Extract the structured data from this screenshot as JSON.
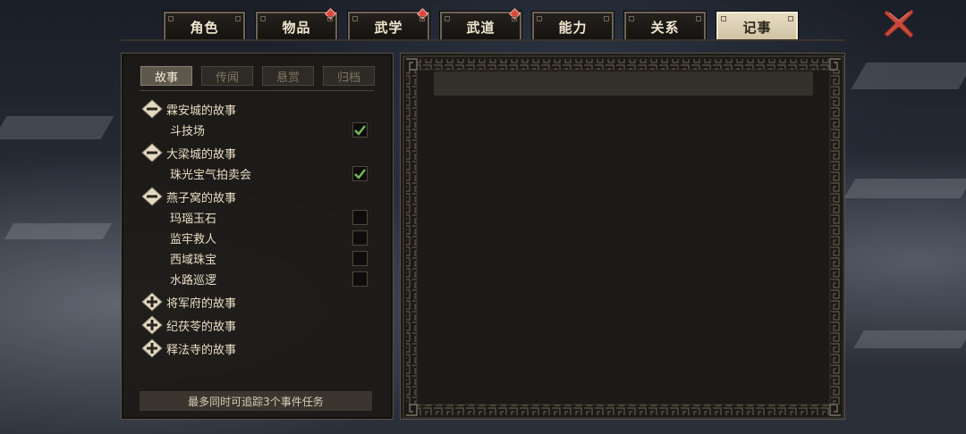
{
  "tabs": [
    {
      "label": "角色",
      "badge": false,
      "active": false
    },
    {
      "label": "物品",
      "badge": true,
      "active": false
    },
    {
      "label": "武学",
      "badge": true,
      "active": false
    },
    {
      "label": "武道",
      "badge": true,
      "active": false
    },
    {
      "label": "能力",
      "badge": false,
      "active": false
    },
    {
      "label": "关系",
      "badge": false,
      "active": false
    },
    {
      "label": "记事",
      "badge": false,
      "active": true
    }
  ],
  "subtabs": [
    {
      "label": "故事",
      "active": true
    },
    {
      "label": "传闻",
      "active": false
    },
    {
      "label": "悬赏",
      "active": false
    },
    {
      "label": "归档",
      "active": false
    }
  ],
  "groups": [
    {
      "title": "霖安城的故事",
      "expanded": true,
      "stories": [
        {
          "label": "斗技场",
          "tracked": true
        }
      ]
    },
    {
      "title": "大梁城的故事",
      "expanded": true,
      "stories": [
        {
          "label": "珠光宝气拍卖会",
          "tracked": true
        }
      ]
    },
    {
      "title": "燕子窝的故事",
      "expanded": true,
      "stories": [
        {
          "label": "玛瑙玉石",
          "tracked": false
        },
        {
          "label": "监牢救人",
          "tracked": false
        },
        {
          "label": "西域珠宝",
          "tracked": false
        },
        {
          "label": "水路巡逻",
          "tracked": false
        }
      ]
    },
    {
      "title": "将军府的故事",
      "expanded": false,
      "stories": []
    },
    {
      "title": "纪茯苓的故事",
      "expanded": false,
      "stories": []
    },
    {
      "title": "释法寺的故事",
      "expanded": false,
      "stories": []
    }
  ],
  "footer_note": "最多同时可追踪3个事件任务",
  "icons": {
    "close": "close-x-icon",
    "expand": "plus-icon",
    "collapse": "minus-icon",
    "check": "checkmark-icon"
  },
  "colors": {
    "tab_active_bg": "#e7dcc2",
    "badge": "#d94a3d",
    "close": "#c94a3c",
    "check": "#6fbf5a",
    "panel_bg": "#1c1a16"
  }
}
